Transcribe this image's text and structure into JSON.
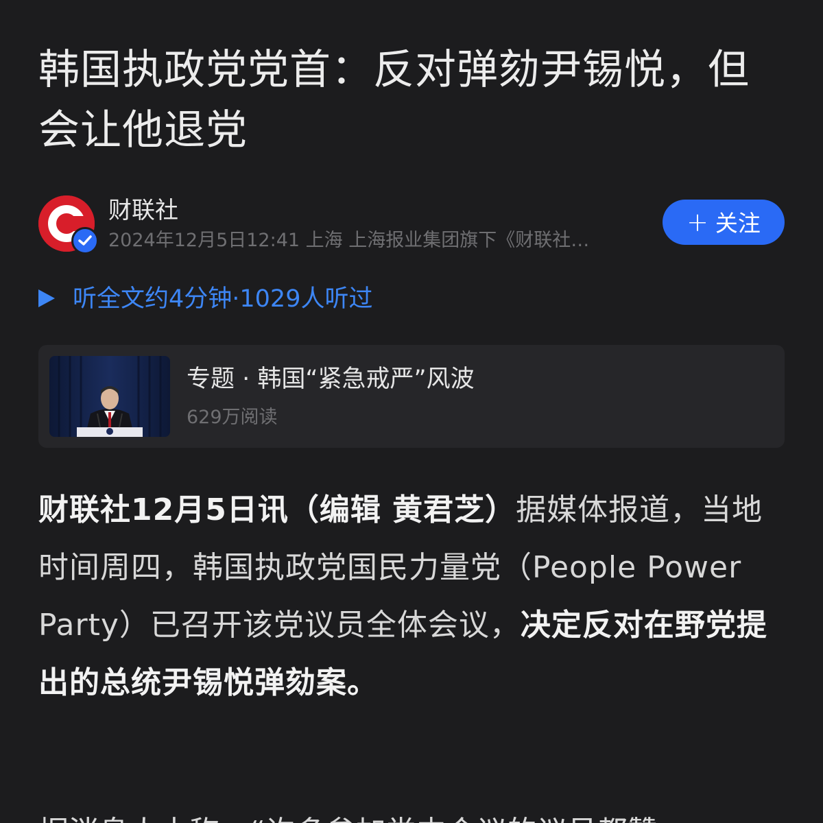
{
  "article": {
    "title": "韩国执政党党首：反对弹劾尹锡悦，但会让他退党"
  },
  "author": {
    "name": "财联社",
    "meta": "2024年12月5日12:41 上海 上海报业集团旗下《财联社…",
    "follow_label": "关注",
    "follow_icon": "plus-icon",
    "avatar_color": "#d81e2a",
    "verified": true
  },
  "listen": {
    "label": "听全文约4分钟·1029人听过",
    "icon": "play-icon",
    "color": "#3d86f5"
  },
  "topic": {
    "title": "专题 · 韩国“紧急戒严”风波",
    "reads": "629万阅读"
  },
  "body": {
    "p1_bold_lead": "财联社12月5日讯（编辑 黄君芝）",
    "p1_text": "据媒体报道，当地时间周四，韩国执政党国民力量党（People Power Party）已召开该党议员全体会议，",
    "p1_bold_tail": "决定反对在野党提出的总统尹锡悦弹劾案。",
    "p2_partial": "据消息人士称，“许多参加党内会议的议员都赞"
  },
  "colors": {
    "background": "#1c1c1e",
    "accent": "#2a6af5"
  }
}
